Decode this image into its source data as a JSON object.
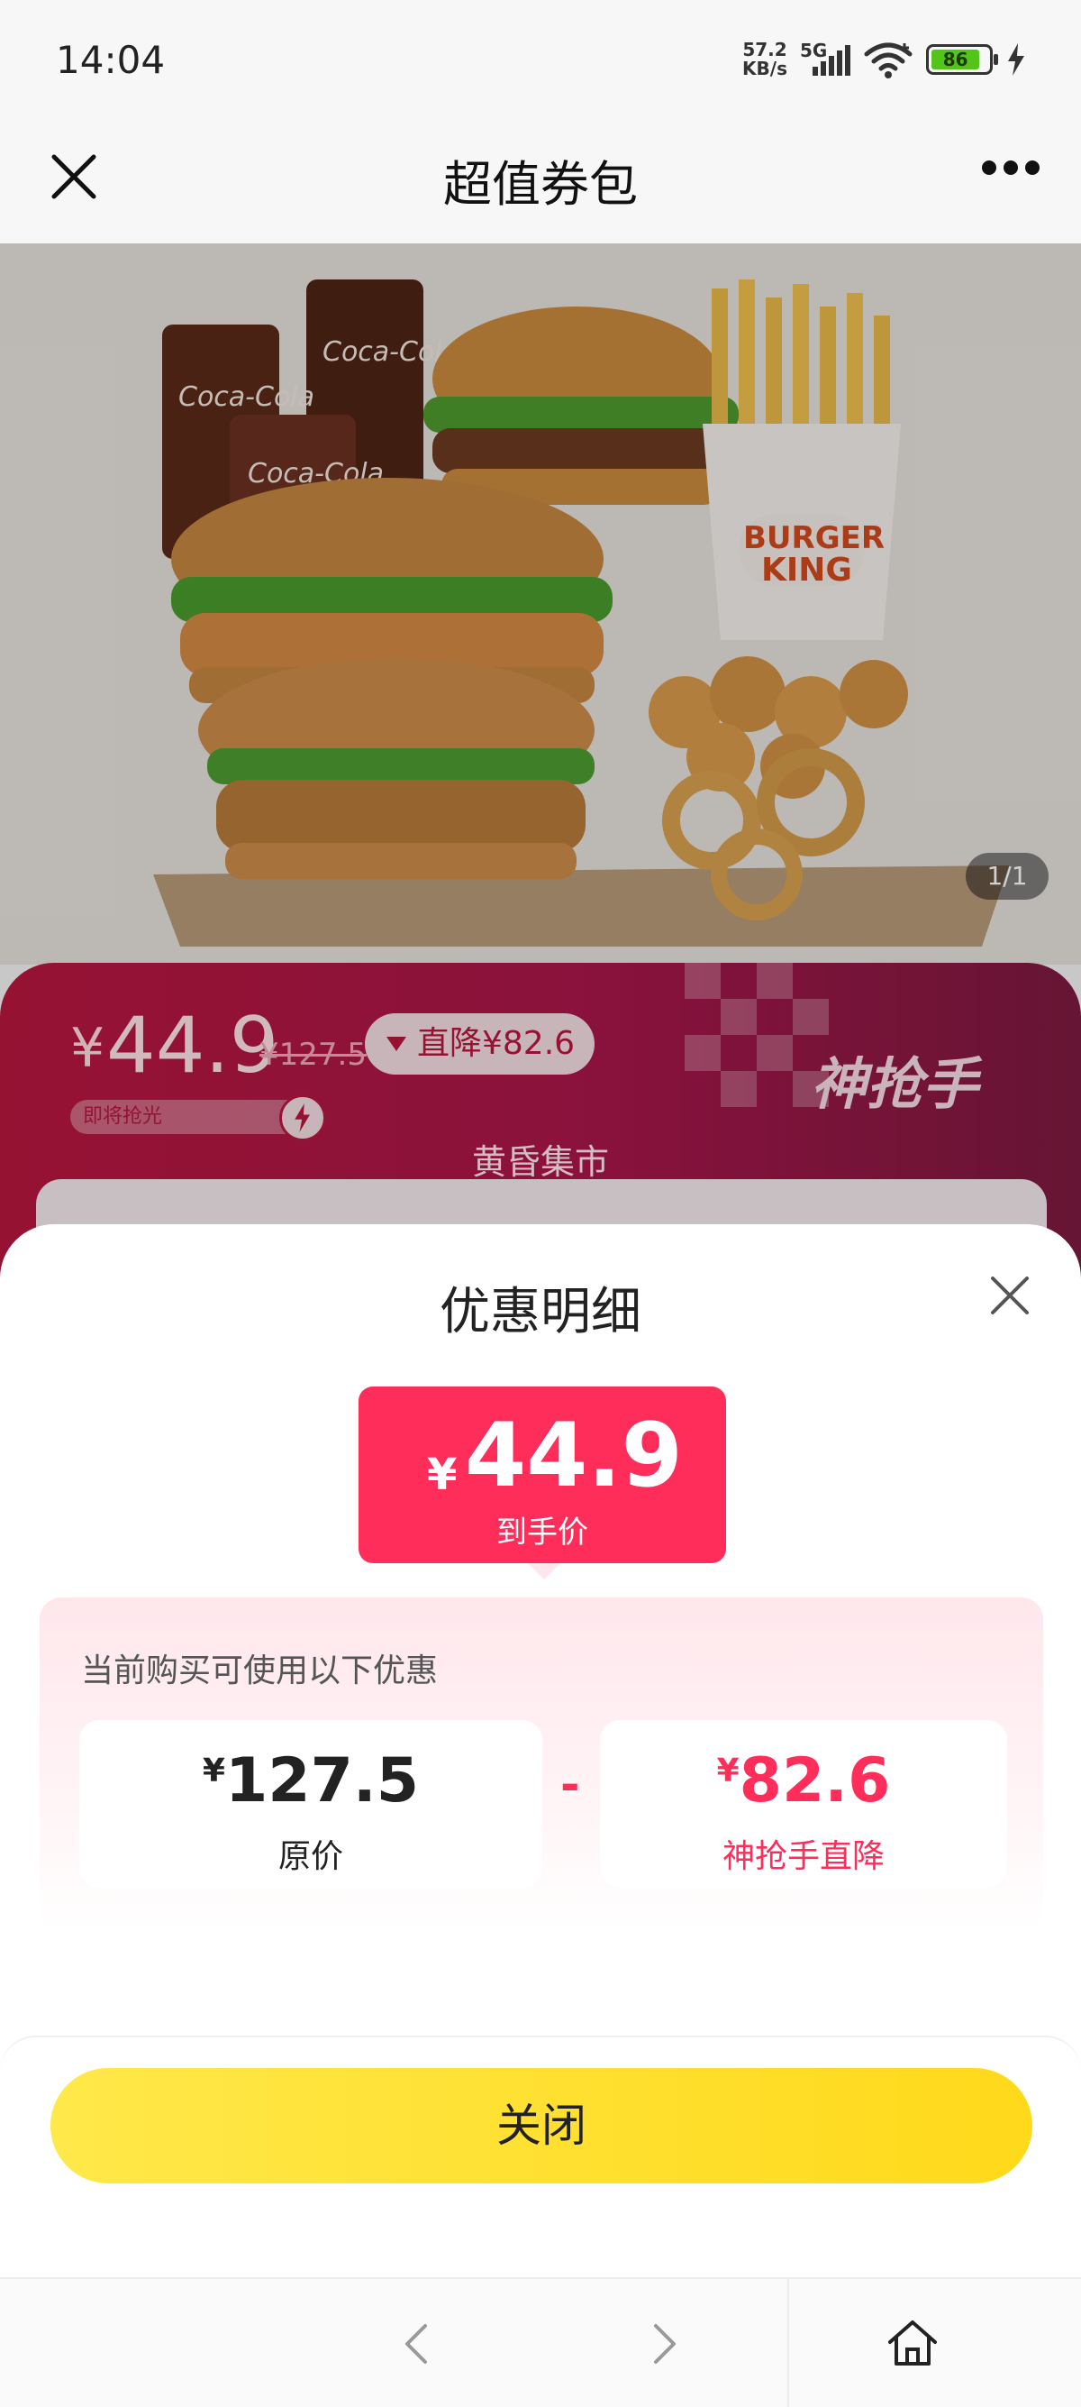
{
  "status_bar": {
    "time": "14:04",
    "net_speed_value": "57.2",
    "net_speed_unit": "KB/s",
    "network": "5G",
    "battery": "86",
    "icons": [
      "signal-icon",
      "wifi-icon",
      "battery-icon",
      "charging-icon"
    ]
  },
  "nav": {
    "title": "超值券包",
    "close_icon": "close-icon",
    "more_icon": "more-icon"
  },
  "hero": {
    "image_counter": "1/1",
    "brand_text_line1": "BURGER",
    "brand_text_line2": "KING",
    "cola_text": "Coca-Cola"
  },
  "price_card": {
    "currency": "¥",
    "price": "44.9",
    "original_price": "¥127.5",
    "drop_label": "直降¥82.6",
    "sell_out_label": "即将抢光",
    "brand_label": "神抢手",
    "market_label": "黄昏集市"
  },
  "sheet": {
    "title": "优惠明细",
    "final_currency": "¥",
    "final_price": "44.9",
    "final_caption": "到手价",
    "hint": "当前购买可使用以下优惠",
    "original": {
      "currency": "¥",
      "amount": "127.5",
      "label": "原价"
    },
    "minus": "-",
    "saving": {
      "currency": "¥",
      "amount": "82.6",
      "label": "神抢手直降"
    },
    "close_button": "关闭"
  },
  "colors": {
    "accent_red": "#ff2d5a",
    "card_red": "#b8173f",
    "button_yellow": "#ffdf2b"
  }
}
